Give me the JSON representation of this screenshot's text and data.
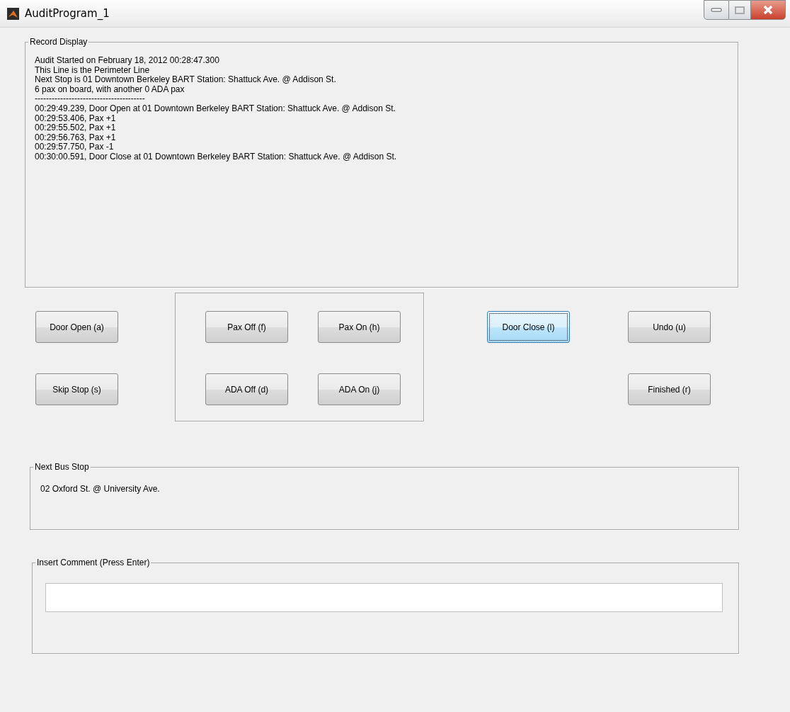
{
  "window": {
    "title": "AuditProgram_1"
  },
  "record_display": {
    "label": "Record Display",
    "lines": [
      "Audit Started on February 18, 2012 00:28:47.300",
      "This Line is the Perimeter Line",
      "Next Stop is 01 Downtown Berkeley BART Station: Shattuck Ave. @ Addison St.",
      "6 pax on board, with another 0 ADA pax",
      "---------------------------------------",
      "00:29:49.239, Door Open at 01 Downtown Berkeley BART Station: Shattuck Ave. @ Addison St.",
      "00:29:53.406, Pax +1",
      "00:29:55.502, Pax +1",
      "00:29:56.763, Pax +1",
      "00:29:57.750, Pax -1",
      "00:30:00.591, Door Close at 01 Downtown Berkeley BART Station: Shattuck Ave. @ Addison St."
    ]
  },
  "left_buttons": [
    {
      "label": "Door Open (a)",
      "focused": false
    },
    {
      "label": "Skip Stop (s)",
      "focused": false
    }
  ],
  "pax_panel": [
    {
      "label": "Pax Off (f)",
      "focused": false
    },
    {
      "label": "Pax On (h)",
      "focused": false
    },
    {
      "label": "ADA Off (d)",
      "focused": false
    },
    {
      "label": "ADA On (j)",
      "focused": false
    }
  ],
  "door_close_button": {
    "label": "Door Close (l)",
    "focused": true
  },
  "right_buttons": [
    {
      "label": "Undo (u)",
      "focused": false
    },
    {
      "label": "Finished (r)",
      "focused": false
    }
  ],
  "next_bus_stop": {
    "label": "Next Bus Stop",
    "value": "02 Oxford St. @ University Ave."
  },
  "comment": {
    "label": "Insert Comment (Press Enter)"
  }
}
